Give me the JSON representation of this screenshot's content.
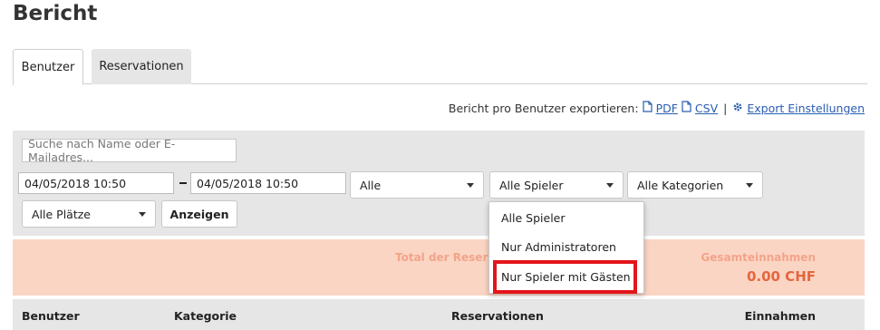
{
  "page": {
    "title": "Bericht"
  },
  "tabs": [
    {
      "label": "Benutzer",
      "active": true
    },
    {
      "label": "Reservationen",
      "active": false
    }
  ],
  "export": {
    "prefix": "Bericht pro Benutzer exportieren:",
    "pdf_label": "PDF",
    "csv_label": "CSV",
    "separator": "|",
    "settings_label": "Export Einstellungen"
  },
  "filters": {
    "search_placeholder": "Suche nach Name oder E-Mailadres...",
    "date_from": "04/05/2018 10:50",
    "date_to": "04/05/2018 10:50",
    "select_alle": "Alle",
    "select_spieler": "Alle Spieler",
    "select_kategorien": "Alle Kategorien",
    "select_plaetze": "Alle Plätze",
    "show_button": "Anzeigen"
  },
  "dropdown": {
    "options": [
      "Alle Spieler",
      "Nur Administratoren",
      "Nur Spieler mit Gästen"
    ],
    "highlighted_index": 2
  },
  "summary": {
    "total_reservations_label": "Total der Reserv",
    "total_income_label": "Gesamteinnahmen",
    "total_income_value": "0.00 CHF"
  },
  "table": {
    "columns": [
      "Benutzer",
      "Kategorie",
      "Reservationen",
      "Einnahmen"
    ]
  },
  "colors": {
    "accent_link": "#2a5db0",
    "summary_bg": "#fbd5c4",
    "summary_value": "#e5663e",
    "highlight_border": "#e3151b"
  }
}
